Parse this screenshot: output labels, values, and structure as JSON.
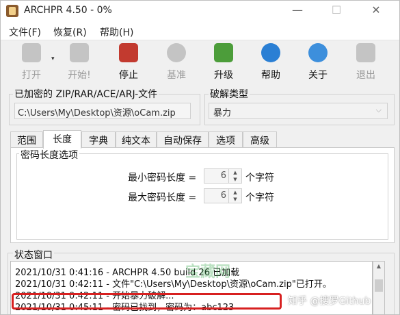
{
  "window": {
    "title": "ARCHPR 4.50 - 0%",
    "minimize": "—",
    "maximize": "☐",
    "close": "✕"
  },
  "menu": [
    "文件(F)",
    "恢复(R)",
    "帮助(H)"
  ],
  "toolbar": [
    {
      "label": "打开",
      "icon": "open-icon",
      "enabled": false
    },
    {
      "label": "开始!",
      "icon": "start-icon",
      "enabled": false
    },
    {
      "label": "停止",
      "icon": "stop-icon",
      "enabled": true
    },
    {
      "label": "基准",
      "icon": "benchmark-icon",
      "enabled": false
    },
    {
      "label": "升级",
      "icon": "upgrade-icon",
      "enabled": true
    },
    {
      "label": "帮助",
      "icon": "help-icon",
      "enabled": true
    },
    {
      "label": "关于",
      "icon": "about-icon",
      "enabled": true
    },
    {
      "label": "退出",
      "icon": "exit-icon",
      "enabled": false
    }
  ],
  "encrypted_file": {
    "title": "已加密的 ZIP/RAR/ACE/ARJ-文件",
    "path": "C:\\Users\\My\\Desktop\\资源\\oCam.zip"
  },
  "attack_type": {
    "title": "破解类型",
    "value": "暴力"
  },
  "tabs": [
    "范围",
    "长度",
    "字典",
    "纯文本",
    "自动保存",
    "选项",
    "高级"
  ],
  "active_tab": "长度",
  "length_options": {
    "title": "密码长度选项",
    "min_label": "最小密码长度 =",
    "min_value": "6",
    "max_label": "最大密码长度 =",
    "max_value": "6",
    "unit": "个字符"
  },
  "status": {
    "title": "状态窗口",
    "lines": [
      "2021/10/31 0:41:16 - ARCHPR 4.50 build 26 已加载",
      "2021/10/31 0:42:11 - 文件\"C:\\Users\\My\\Desktop\\资源\\oCam.zip\"已打开。",
      "2021/10/31 0:42:11 - 开始暴力破解...",
      "2021/10/31 0:45:11 - 密码已找到，密码为：abc123"
    ]
  },
  "watermark": {
    "text": "知乎 @搜罗Github"
  },
  "colors": {
    "highlight": "#d72020"
  }
}
